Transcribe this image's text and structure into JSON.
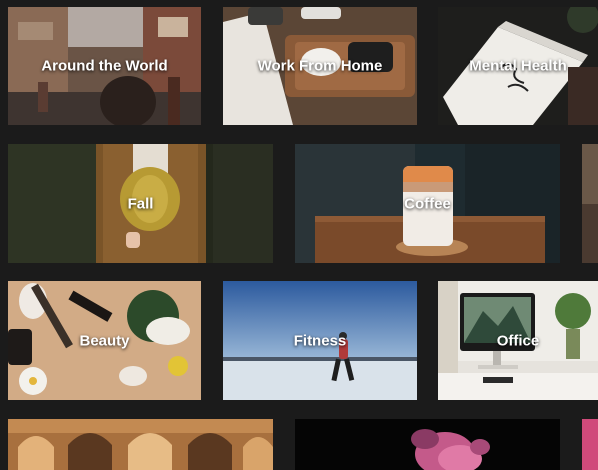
{
  "categories": [
    {
      "label": "Around the World"
    },
    {
      "label": "Work From Home"
    },
    {
      "label": "Mental Health"
    },
    {
      "label": "Fall"
    },
    {
      "label": "Coffee"
    },
    {
      "label": "Beauty"
    },
    {
      "label": "Fitness"
    },
    {
      "label": "Office"
    }
  ],
  "colors": {
    "background": "#1b1b1b",
    "label_text": "#ffffff"
  }
}
